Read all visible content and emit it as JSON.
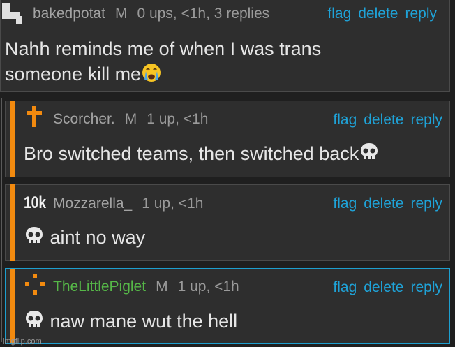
{
  "comments": [
    {
      "user": "bakedpotat",
      "gender": "M",
      "stats": "0 ups, <1h, 3 replies",
      "line1": "Nahh reminds me of when I was trans",
      "line2": "someone kill me"
    },
    {
      "user": "Scorcher.",
      "gender": "M",
      "stats": "1 up, <1h",
      "text": "Bro switched teams, then switched back"
    },
    {
      "user": "Mozzarella_",
      "badge": "10k",
      "stats": "1 up, <1h",
      "text": "aint no way"
    },
    {
      "user": "TheLittlePiglet",
      "gender": "M",
      "stats": "1 up, <1h",
      "text": "naw mane wut the hell"
    }
  ],
  "actions": {
    "flag": "flag",
    "delete": "delete",
    "reply": "reply"
  },
  "watermark": "imgflip.com",
  "colors": {
    "accent_bar": "#f28a0f",
    "link": "#1fa3d8",
    "highlight_border": "#1d9fcf",
    "green_user": "#56b848"
  }
}
